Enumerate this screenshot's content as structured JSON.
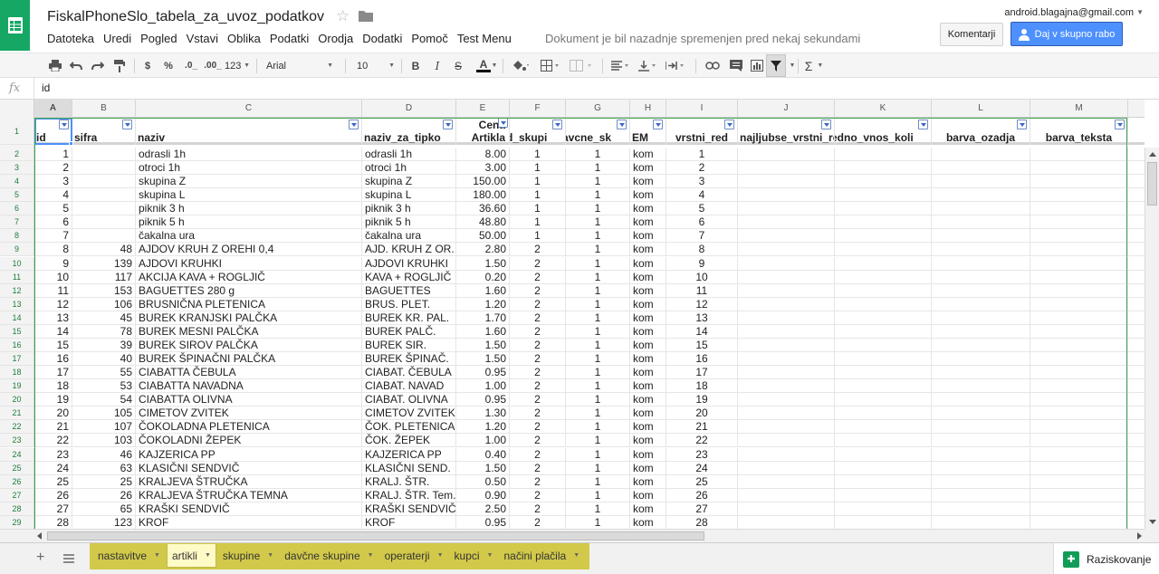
{
  "doc": {
    "title": "FiskalPhoneSlo_tabela_za_uvoz_podatkov",
    "save_status": "Dokument je bil nazadnje spremenjen pred nekaj sekundami",
    "account": "android.blagajna@gmail.com"
  },
  "menu": [
    "Datoteka",
    "Uredi",
    "Pogled",
    "Vstavi",
    "Oblika",
    "Podatki",
    "Orodja",
    "Dodatki",
    "Pomoč",
    "Test Menu"
  ],
  "buttons": {
    "comments": "Komentarji",
    "share": "Daj v skupno rabo"
  },
  "toolbar": {
    "currency": "$",
    "percent": "%",
    "dec_less": ".0_",
    "dec_more": ".00_",
    "number_format": "123",
    "font": "Arial",
    "font_size": "10",
    "bold": "B",
    "italic": "I",
    "strike": "S",
    "text_color": "A",
    "functions": "Σ"
  },
  "formula": {
    "fx": "fx",
    "value": "id"
  },
  "columns": [
    "A",
    "B",
    "C",
    "D",
    "E",
    "F",
    "G",
    "H",
    "I",
    "J",
    "K",
    "L",
    "M"
  ],
  "header_row": {
    "row_number": "1",
    "cells": [
      "id",
      "sifra",
      "naziv",
      "naziv_za_tipko",
      "Cena Artikla",
      "d_skupi",
      "avcne_sk",
      "EM",
      "vrstni_red",
      "najljubse_vrstni_red",
      "edno_vnos_koli",
      "barva_ozadja",
      "barva_teksta"
    ],
    "cena_line1": "Cena",
    "cena_line2": "Artikla"
  },
  "rows": [
    {
      "rn": "2",
      "id": "1",
      "sifra": "",
      "naziv": "odrasli 1h",
      "tipka": "odrasli 1h",
      "cena": "8.00",
      "sk": "1",
      "dav": "1",
      "em": "kom",
      "vr": "1"
    },
    {
      "rn": "3",
      "id": "2",
      "sifra": "",
      "naziv": "otroci 1h",
      "tipka": "otroci 1h",
      "cena": "3.00",
      "sk": "1",
      "dav": "1",
      "em": "kom",
      "vr": "2"
    },
    {
      "rn": "4",
      "id": "3",
      "sifra": "",
      "naziv": "skupina Z",
      "tipka": "skupina Z",
      "cena": "150.00",
      "sk": "1",
      "dav": "1",
      "em": "kom",
      "vr": "3"
    },
    {
      "rn": "5",
      "id": "4",
      "sifra": "",
      "naziv": "skupina L",
      "tipka": "skupina L",
      "cena": "180.00",
      "sk": "1",
      "dav": "1",
      "em": "kom",
      "vr": "4"
    },
    {
      "rn": "6",
      "id": "5",
      "sifra": "",
      "naziv": "piknik 3 h",
      "tipka": "piknik 3 h",
      "cena": "36.60",
      "sk": "1",
      "dav": "1",
      "em": "kom",
      "vr": "5"
    },
    {
      "rn": "7",
      "id": "6",
      "sifra": "",
      "naziv": "piknik 5 h",
      "tipka": "piknik 5 h",
      "cena": "48.80",
      "sk": "1",
      "dav": "1",
      "em": "kom",
      "vr": "6"
    },
    {
      "rn": "8",
      "id": "7",
      "sifra": "",
      "naziv": "čakalna ura",
      "tipka": "čakalna ura",
      "cena": "50.00",
      "sk": "1",
      "dav": "1",
      "em": "kom",
      "vr": "7"
    },
    {
      "rn": "9",
      "id": "8",
      "sifra": "48",
      "naziv": "AJDOV KRUH Z OREHI 0,4",
      "tipka": "AJD. KRUH Z OR.",
      "cena": "2.80",
      "sk": "2",
      "dav": "1",
      "em": "kom",
      "vr": "8"
    },
    {
      "rn": "10",
      "id": "9",
      "sifra": "139",
      "naziv": "AJDOVI KRUHKI",
      "tipka": "AJDOVI KRUHKI",
      "cena": "1.50",
      "sk": "2",
      "dav": "1",
      "em": "kom",
      "vr": "9"
    },
    {
      "rn": "11",
      "id": "10",
      "sifra": "117",
      "naziv": "AKCIJA  KAVA + ROGLJIČ",
      "tipka": "KAVA + ROGLJIČ",
      "cena": "0.20",
      "sk": "2",
      "dav": "1",
      "em": "kom",
      "vr": "10"
    },
    {
      "rn": "12",
      "id": "11",
      "sifra": "153",
      "naziv": "BAGUETTES 280 g",
      "tipka": "BAGUETTES",
      "cena": "1.60",
      "sk": "2",
      "dav": "1",
      "em": "kom",
      "vr": "11"
    },
    {
      "rn": "13",
      "id": "12",
      "sifra": "106",
      "naziv": "BRUSNIČNA PLETENICA",
      "tipka": "BRUS. PLET.",
      "cena": "1.20",
      "sk": "2",
      "dav": "1",
      "em": "kom",
      "vr": "12"
    },
    {
      "rn": "14",
      "id": "13",
      "sifra": "45",
      "naziv": "BUREK KRANJSKI PALČKA",
      "tipka": "BUREK KR. PAL.",
      "cena": "1.70",
      "sk": "2",
      "dav": "1",
      "em": "kom",
      "vr": "13"
    },
    {
      "rn": "15",
      "id": "14",
      "sifra": "78",
      "naziv": "BUREK MESNI PALČKA",
      "tipka": "BUREK PALČ.",
      "cena": "1.60",
      "sk": "2",
      "dav": "1",
      "em": "kom",
      "vr": "14"
    },
    {
      "rn": "16",
      "id": "15",
      "sifra": "39",
      "naziv": "BUREK SIROV PALČKA",
      "tipka": "BUREK SIR.",
      "cena": "1.50",
      "sk": "2",
      "dav": "1",
      "em": "kom",
      "vr": "15"
    },
    {
      "rn": "17",
      "id": "16",
      "sifra": "40",
      "naziv": "BUREK ŠPINAČNI PALČKA",
      "tipka": "BUREK ŠPINAČ.",
      "cena": "1.50",
      "sk": "2",
      "dav": "1",
      "em": "kom",
      "vr": "16"
    },
    {
      "rn": "18",
      "id": "17",
      "sifra": "55",
      "naziv": "CIABATTA ČEBULA",
      "tipka": "CIABAT. ČEBULA",
      "cena": "0.95",
      "sk": "2",
      "dav": "1",
      "em": "kom",
      "vr": "17"
    },
    {
      "rn": "19",
      "id": "18",
      "sifra": "53",
      "naziv": "CIABATTA NAVADNA",
      "tipka": "CIABAT. NAVAD",
      "cena": "1.00",
      "sk": "2",
      "dav": "1",
      "em": "kom",
      "vr": "18"
    },
    {
      "rn": "20",
      "id": "19",
      "sifra": "54",
      "naziv": "CIABATTA OLIVNA",
      "tipka": "CIABAT. OLIVNA",
      "cena": "0.95",
      "sk": "2",
      "dav": "1",
      "em": "kom",
      "vr": "19"
    },
    {
      "rn": "21",
      "id": "20",
      "sifra": "105",
      "naziv": "CIMETOV ZVITEK",
      "tipka": "CIMETOV ZVITEK",
      "cena": "1.30",
      "sk": "2",
      "dav": "1",
      "em": "kom",
      "vr": "20"
    },
    {
      "rn": "22",
      "id": "21",
      "sifra": "107",
      "naziv": "ČOKOLADNA PLETENICA",
      "tipka": "ČOK. PLETENICA",
      "cena": "1.20",
      "sk": "2",
      "dav": "1",
      "em": "kom",
      "vr": "21"
    },
    {
      "rn": "23",
      "id": "22",
      "sifra": "103",
      "naziv": "ČOKOLADNI ŽEPEK",
      "tipka": "ČOK. ŽEPEK",
      "cena": "1.00",
      "sk": "2",
      "dav": "1",
      "em": "kom",
      "vr": "22"
    },
    {
      "rn": "24",
      "id": "23",
      "sifra": "46",
      "naziv": "KAJZERICA PP",
      "tipka": "KAJZERICA PP",
      "cena": "0.40",
      "sk": "2",
      "dav": "1",
      "em": "kom",
      "vr": "23"
    },
    {
      "rn": "25",
      "id": "24",
      "sifra": "63",
      "naziv": "KLASIČNI SENDVIČ",
      "tipka": "KLASIČNI SEND.",
      "cena": "1.50",
      "sk": "2",
      "dav": "1",
      "em": "kom",
      "vr": "24"
    },
    {
      "rn": "26",
      "id": "25",
      "sifra": "25",
      "naziv": "KRALJEVA  ŠTRUČKA",
      "tipka": "KRALJ.  ŠTR.",
      "cena": "0.50",
      "sk": "2",
      "dav": "1",
      "em": "kom",
      "vr": "25"
    },
    {
      "rn": "27",
      "id": "26",
      "sifra": "26",
      "naziv": "KRALJEVA ŠTRUČKA TEMNA",
      "tipka": "KRALJ. ŠTR. Tem.",
      "cena": "0.90",
      "sk": "2",
      "dav": "1",
      "em": "kom",
      "vr": "26"
    },
    {
      "rn": "28",
      "id": "27",
      "sifra": "65",
      "naziv": "KRAŠKI SENDVIČ",
      "tipka": "KRAŠKI SENDVIČ",
      "cena": "2.50",
      "sk": "2",
      "dav": "1",
      "em": "kom",
      "vr": "27"
    },
    {
      "rn": "29",
      "id": "28",
      "sifra": "123",
      "naziv": "KROF",
      "tipka": "KROF",
      "cena": "0.95",
      "sk": "2",
      "dav": "1",
      "em": "kom",
      "vr": "28"
    }
  ],
  "sheets": [
    "nastavitve",
    "artikli",
    "skupine",
    "davčne skupine",
    "operaterji",
    "kupci",
    "načini plačila"
  ],
  "active_sheet": "artikli",
  "explore_label": "Raziskovanje",
  "colors": {
    "brand_green": "#16a765",
    "share_blue": "#4d90fe",
    "tab_strip": "#d2c94a",
    "filter_border": "#3fa34d"
  }
}
